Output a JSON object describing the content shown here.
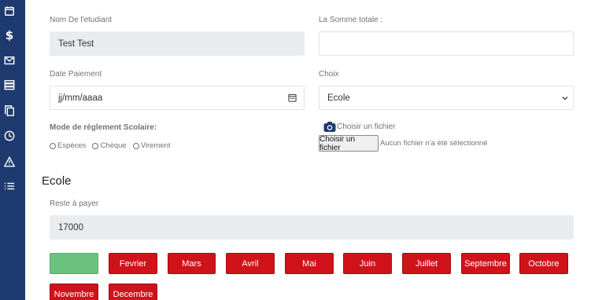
{
  "sidebar": {
    "icons": [
      "calendar-icon",
      "dollar-icon",
      "mail-icon",
      "server-icon",
      "copy-icon",
      "clock-icon",
      "warning-icon",
      "list-icon"
    ],
    "dollar_glyph": "$"
  },
  "form": {
    "student_name_label": "Nom De l'etudiant",
    "student_name_value": "Test Test",
    "total_label": "La Somme totale :",
    "total_value": "",
    "date_label": "Date Paiement",
    "date_placeholder": "jj/mm/aaaa",
    "choice_label": "Choix",
    "choice_value": "Ecole",
    "payment_mode_label": "Mode de règlement Scolaire:",
    "payment_options": [
      "Espèces",
      "Chèque",
      "Virement"
    ],
    "file_label": "Choisir un fichier",
    "file_button": "Choisir un fichier",
    "file_status": "Aucun fichier n'a été sélectionné"
  },
  "section": {
    "title": "Ecole",
    "remaining_label": "Reste à payer",
    "remaining_value": "17000"
  },
  "months": [
    "",
    "Fevrier",
    "Mars",
    "Avril",
    "Mai",
    "Juin",
    "Juillet",
    "Septembre",
    "Octobre",
    "Novembre",
    "Decembre"
  ],
  "colors": {
    "sidebar": "#1e3a6e",
    "unpaid": "#d0121b",
    "paid": "#6bc17e",
    "readonly_field": "#e9ecef"
  }
}
